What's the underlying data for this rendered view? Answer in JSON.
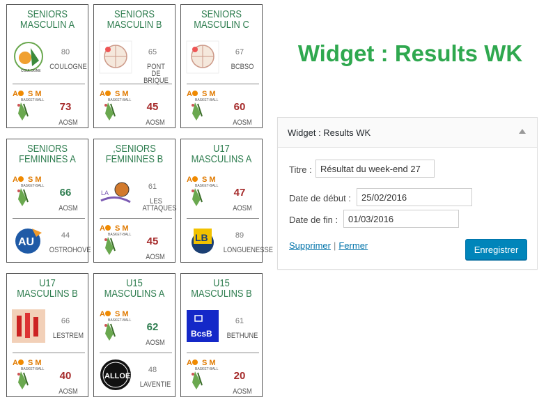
{
  "results": [
    {
      "title": "SENIORS MASCULIN A",
      "team1": {
        "score": "80",
        "name": "COULOGNE",
        "logo": "coulogne-logo-icon",
        "emph": false
      },
      "team2": {
        "score": "73",
        "name": "AOSM",
        "logo": "aosm-logo-icon",
        "emph": true,
        "color": "red"
      }
    },
    {
      "title": "SENIORS MASCULIN B",
      "team1": {
        "score": "65",
        "name": "PONT DE BRIQUE",
        "logo": "pont-de-brique-logo-icon",
        "emph": false
      },
      "team2": {
        "score": "45",
        "name": "AOSM",
        "logo": "aosm-logo-icon",
        "emph": true,
        "color": "red"
      }
    },
    {
      "title": "SENIORS MASCULIN C",
      "team1": {
        "score": "67",
        "name": "BCBSO",
        "logo": "bcbso-logo-icon",
        "emph": false
      },
      "team2": {
        "score": "60",
        "name": "AOSM",
        "logo": "aosm-logo-icon",
        "emph": true,
        "color": "red"
      }
    },
    {
      "title": "SENIORS FEMININES A",
      "team1": {
        "score": "66",
        "name": "AOSM",
        "logo": "aosm-logo-icon",
        "emph": true,
        "color": "green"
      },
      "team2": {
        "score": "44",
        "name": "OSTROHOVE",
        "logo": "ostrohove-logo-icon",
        "emph": false
      }
    },
    {
      "title": ",SENIORS FEMININES B",
      "team1": {
        "score": "61",
        "name": "LES ATTAQUES",
        "logo": "les-attaques-logo-icon",
        "emph": false
      },
      "team2": {
        "score": "45",
        "name": "AOSM",
        "logo": "aosm-logo-icon",
        "emph": true,
        "color": "red"
      }
    },
    {
      "title": "U17 MASCULINS A",
      "team1": {
        "score": "47",
        "name": "AOSM",
        "logo": "aosm-logo-icon",
        "emph": true,
        "color": "red"
      },
      "team2": {
        "score": "89",
        "name": "LONGUENESSE",
        "logo": "longuenesse-logo-icon",
        "emph": false
      }
    },
    {
      "title": "U17 MASCULINS B",
      "team1": {
        "score": "66",
        "name": "LESTREM",
        "logo": "lestrem-logo-icon",
        "emph": false
      },
      "team2": {
        "score": "40",
        "name": "AOSM",
        "logo": "aosm-logo-icon",
        "emph": true,
        "color": "red"
      }
    },
    {
      "title": "U15 MASCULINS A",
      "team1": {
        "score": "62",
        "name": "AOSM",
        "logo": "aosm-logo-icon",
        "emph": true,
        "color": "green"
      },
      "team2": {
        "score": "48",
        "name": "LAVENTIE",
        "logo": "laventie-logo-icon",
        "emph": false
      }
    },
    {
      "title": "U15 MASCULINS B",
      "team1": {
        "score": "61",
        "name": "BETHUNE",
        "logo": "bethune-logo-icon",
        "emph": false
      },
      "team2": {
        "score": "20",
        "name": "AOSM",
        "logo": "aosm-logo-icon",
        "emph": true,
        "color": "red"
      }
    }
  ],
  "page_title": "Widget : Results WK",
  "widget": {
    "header": "Widget : Results WK",
    "title_label": "Titre :",
    "title_value": "Résultat du week-end 27",
    "start_label": "Date de début :",
    "start_value": "25/02/2016",
    "end_label": "Date de fin :",
    "end_value": "01/03/2016",
    "delete_label": "Supprimer",
    "separator": "|",
    "close_label": "Fermer",
    "save_label": "Enregistrer"
  },
  "colors": {
    "green": "#2e7d4f",
    "red": "#a52a2a",
    "accent": "#2fa84f",
    "button": "#0085ba",
    "link": "#0073aa"
  }
}
